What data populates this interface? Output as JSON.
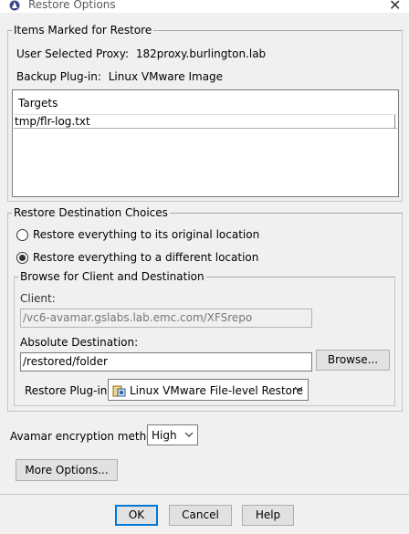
{
  "window": {
    "title": "Restore Options",
    "close_symbol": "✕"
  },
  "items_marked": {
    "legend": "Items Marked for Restore",
    "proxy_label": "User Selected Proxy:",
    "proxy_value": "182proxy.burlington.lab",
    "plugin_label": "Backup Plug-in:",
    "plugin_value": "Linux VMware Image",
    "targets_header": "Targets",
    "targets": [
      "tmp/flr-log.txt"
    ]
  },
  "destination": {
    "legend": "Restore Destination Choices",
    "option_original": "Restore everything to its original location",
    "option_different": "Restore everything to a different location",
    "selected": "different",
    "browse_group": {
      "legend": "Browse for Client and Destination",
      "client_label": "Client:",
      "client_value": "/vc6-avamar.gslabs.lab.emc.com/XFSrepo",
      "abs_dest_label": "Absolute Destination:",
      "abs_dest_value": "/restored/folder",
      "browse_button": "Browse...",
      "plugin_label": "Restore Plug-in",
      "plugin_selected": "Linux VMware File-level Restore"
    }
  },
  "encryption": {
    "label": "Avamar encryption method",
    "selected": "High"
  },
  "more_options_button": "More Options...",
  "footer": {
    "ok": "OK",
    "cancel": "Cancel",
    "help": "Help"
  },
  "colors": {
    "background": "#f0f0f0",
    "default_button_border": "#0078d7"
  }
}
